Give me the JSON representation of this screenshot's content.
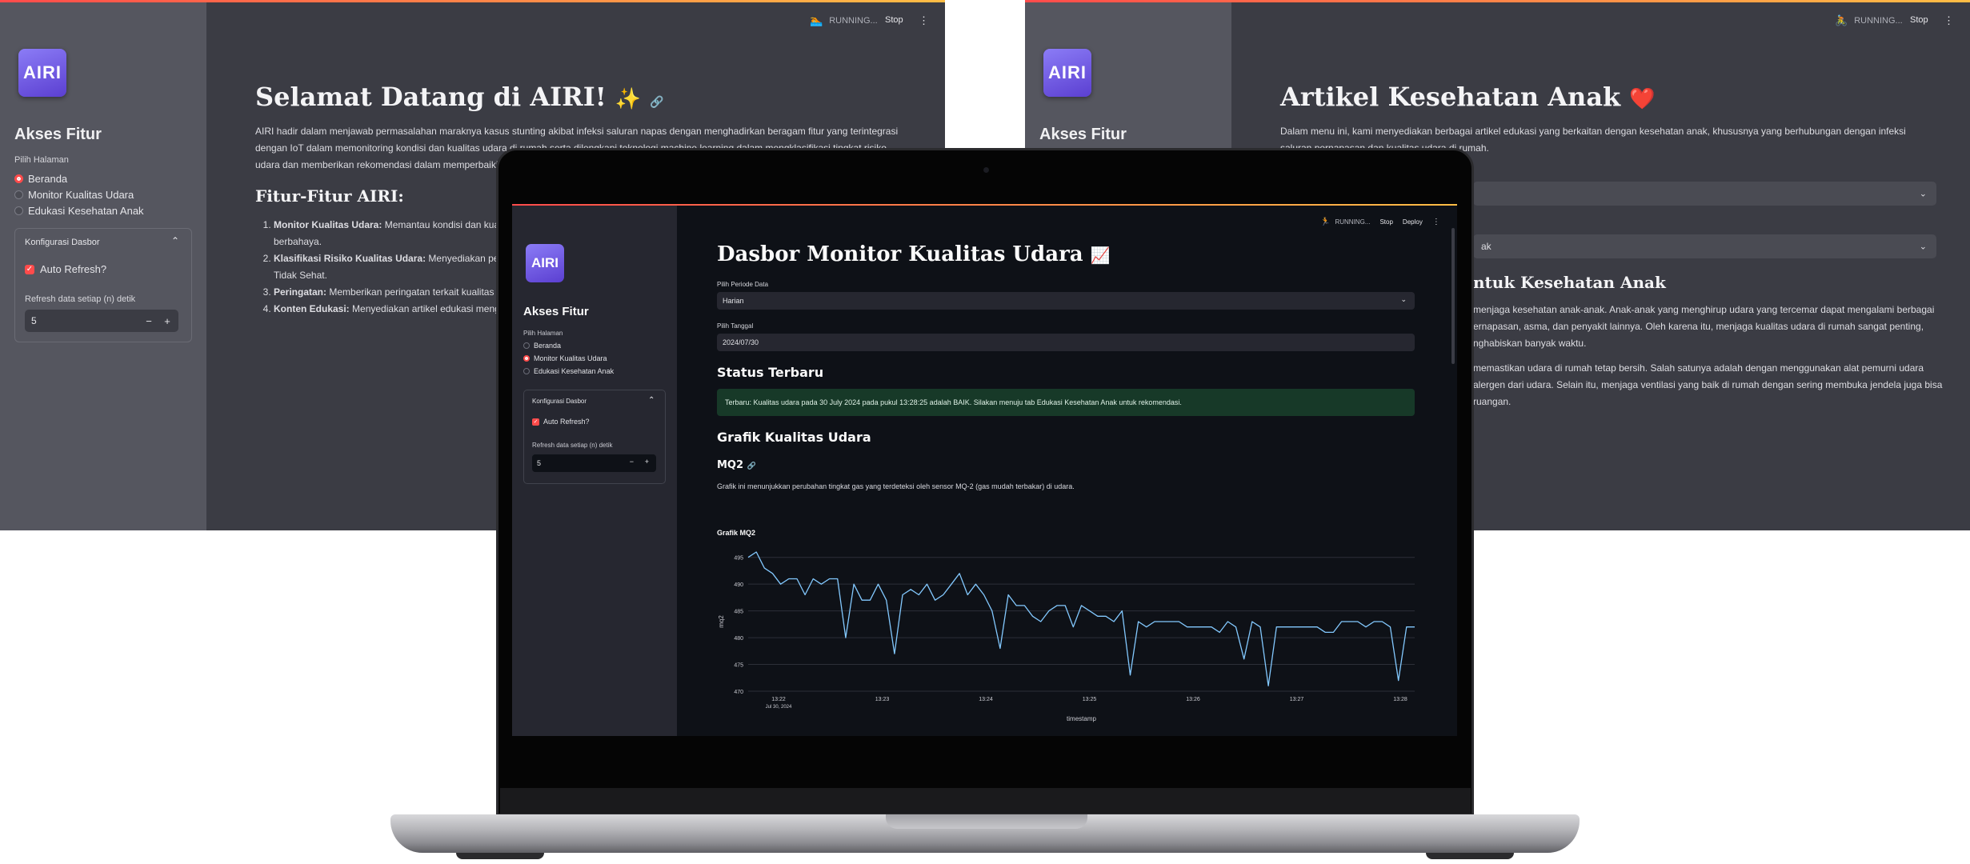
{
  "left_panel": {
    "status": "RUNNING...",
    "stop": "Stop",
    "more": "⋮",
    "logo": "AIRI",
    "sidebar_title": "Akses Fitur",
    "page_label": "Pilih Halaman",
    "pages": [
      "Beranda",
      "Monitor Kualitas Udara",
      "Edukasi Kesehatan Anak"
    ],
    "selected_page": "Beranda",
    "config_title": "Konfigurasi Dasbor",
    "auto_refresh": "Auto Refresh?",
    "refresh_label": "Refresh data setiap (n) detik",
    "refresh_value": "5",
    "title": "Selamat Datang di AIRI!",
    "title_emoji": "✨",
    "intro": "AIRI hadir dalam menjawab permasalahan maraknya kasus stunting akibat infeksi saluran napas dengan menghadirkan beragam fitur yang terintegrasi dengan IoT dalam memonitoring kondisi dan kualitas udara di rumah serta dilengkapi teknologi machine learning dalam mengklasifikasi tingkat risiko udara dan memberikan rekomendasi dalam memperbaiki d",
    "features_title": "Fitur-Fitur AIRI:",
    "features": [
      {
        "name": "Monitor Kualitas Udara:",
        "desc": "Memantau kondisi dan kualita",
        "desc2": "berbahaya."
      },
      {
        "name": "Klasifikasi Risiko Kualitas Udara:",
        "desc": "Menyediakan penilai",
        "desc2": "Tidak Sehat."
      },
      {
        "name": "Peringatan:",
        "desc": "Memberikan peringatan terkait kualitas ud",
        "desc2": ""
      },
      {
        "name": "Konten Edukasi:",
        "desc": "Menyediakan artikel edukasi mengen",
        "desc2": ""
      }
    ]
  },
  "right_panel": {
    "status": "RUNNING...",
    "stop": "Stop",
    "more": "⋮",
    "logo": "AIRI",
    "sidebar_title": "Akses Fitur",
    "title": "Artikel Kesehatan Anak",
    "title_emoji": "❤️",
    "intro": "Dalam menu ini, kami menyediakan berbagai artikel edukasi yang berkaitan dengan kesehatan anak, khususnya yang berhubungan dengan infeksi saluran pernapasan dan kualitas udara di rumah.",
    "select2_value": "ak",
    "subheading": "ntuk Kesehatan Anak",
    "para1": [
      "menjaga kesehatan anak-anak. Anak-anak yang menghirup udara yang tercemar dapat mengalami berbagai",
      "ernapasan, asma, dan penyakit lainnya. Oleh karena itu, menjaga kualitas udara di rumah sangat penting,",
      "nghabiskan banyak waktu."
    ],
    "para2": [
      "memastikan udara di rumah tetap bersih. Salah satunya adalah dengan menggunakan alat pemurni udara",
      "alergen dari udara. Selain itu, menjaga ventilasi yang baik di rumah dengan sering membuka jendela juga bisa",
      "ruangan."
    ]
  },
  "screen": {
    "status": "RUNNING...",
    "stop": "Stop",
    "deploy": "Deploy",
    "more": "⋮",
    "logo": "AIRI",
    "sidebar_title": "Akses Fitur",
    "page_label": "Pilih Halaman",
    "pages": [
      "Beranda",
      "Monitor Kualitas Udara",
      "Edukasi Kesehatan Anak"
    ],
    "selected_page": "Monitor Kualitas Udara",
    "config_title": "Konfigurasi Dasbor",
    "auto_refresh": "Auto Refresh?",
    "refresh_label": "Refresh data setiap (n) detik",
    "refresh_value": "5",
    "title": "Dasbor Monitor Kualitas Udara",
    "title_emoji": "📈",
    "period_label": "Pilih Periode Data",
    "period_value": "Harian",
    "date_label": "Pilih Tanggal",
    "date_value": "2024/07/30",
    "status_heading": "Status Terbaru",
    "status_message": "Terbaru: Kualitas udara pada 30 July 2024 pada pukul 13:28:25 adalah BAIK. Silakan menuju tab Edukasi Kesehatan Anak untuk rekomendasi.",
    "chart_heading": "Grafik Kualitas Udara",
    "mq2_heading": "MQ2",
    "mq2_desc": "Grafik ini menunjukkan perubahan tingkat gas yang terdeteksi oleh sensor MQ-2 (gas mudah terbakar) di udara."
  },
  "colors": {
    "accent": "#ff4b4b",
    "line": "#83c9ff",
    "alert_bg": "#173928"
  },
  "chart_data": {
    "type": "line",
    "title": "Grafik MQ2",
    "xlabel": "timestamp",
    "ylabel": "mq2",
    "x_tick_labels": [
      "13:22",
      "13:23",
      "13:24",
      "13:25",
      "13:26",
      "13:27",
      "13:28"
    ],
    "x_tick_sublabel": "Jul 30, 2024",
    "x_range": [
      "13:22",
      "13:28:25"
    ],
    "ylim": [
      470,
      496
    ],
    "y_ticks": [
      470,
      475,
      480,
      485,
      490,
      495
    ],
    "grid": true,
    "series": [
      {
        "values": [
          495,
          496,
          493,
          492,
          490,
          491,
          491,
          488,
          491,
          490,
          491,
          491,
          480,
          490,
          487,
          487,
          490,
          487,
          477,
          488,
          489,
          488,
          490,
          487,
          488,
          490,
          492,
          488,
          490,
          488,
          485,
          478,
          488,
          486,
          486,
          484,
          483,
          485,
          486,
          486,
          482,
          486,
          485,
          484,
          484,
          483,
          485,
          473,
          483,
          482,
          483,
          483,
          483,
          483,
          482,
          482,
          482,
          482,
          481,
          483,
          482,
          476,
          483,
          482,
          471,
          482,
          482,
          482,
          482,
          482,
          482,
          481,
          481,
          483,
          483,
          483,
          482,
          483,
          483,
          482,
          472,
          482,
          482
        ]
      }
    ]
  }
}
